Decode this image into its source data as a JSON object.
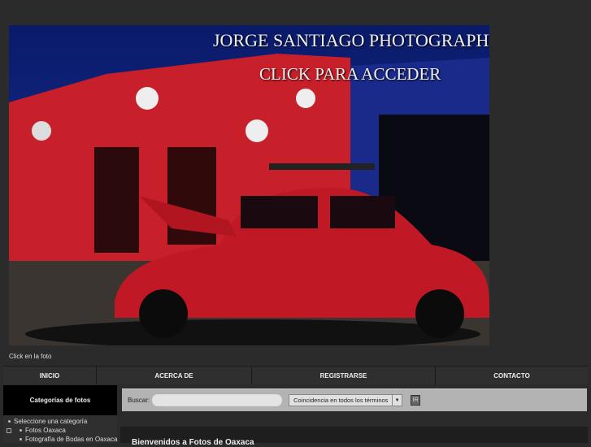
{
  "header_image": {
    "title": "JORGE SANTIAGO PHOTOGRAPHY",
    "subtitle": "CLICK PARA ACCEDER",
    "caption": "Click en la foto"
  },
  "nav": {
    "items": [
      {
        "label": "INICIO"
      },
      {
        "label": "ACERCA DE"
      },
      {
        "label": "REGISTRARSE"
      },
      {
        "label": "CONTACTO"
      }
    ]
  },
  "sidebar": {
    "title": "Categorías de fotos",
    "items": [
      {
        "label": "Seleccione una categoría"
      },
      {
        "label": "Fotos Oaxaca"
      },
      {
        "label": "Fotografía de Bodas en Oaxaca"
      }
    ]
  },
  "search": {
    "label": "Buscar:",
    "value": "",
    "placeholder": "",
    "match_option": "Coincidencia en todos los términos",
    "submit_label": "IR"
  },
  "main": {
    "heading": "Bienvenidos a Fotos de Oaxaca"
  }
}
